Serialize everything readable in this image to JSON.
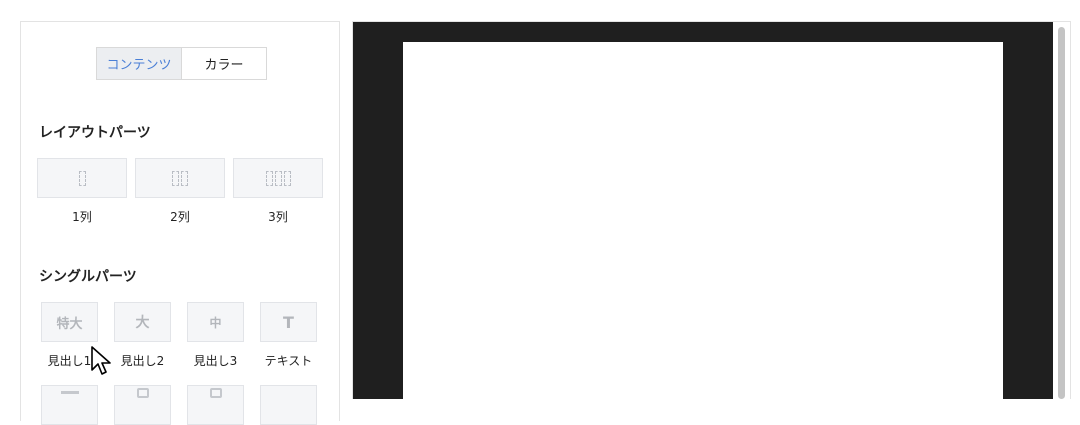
{
  "tabs": {
    "contents": "コンテンツ",
    "color": "カラー"
  },
  "layout_parts": {
    "title": "レイアウトパーツ",
    "items": [
      {
        "label": "1列"
      },
      {
        "label": "2列"
      },
      {
        "label": "3列"
      }
    ]
  },
  "single_parts": {
    "title": "シングルパーツ",
    "items": [
      {
        "icon_text": "特大",
        "label": "見出し1"
      },
      {
        "icon_text": "大",
        "label": "見出し2"
      },
      {
        "icon_text": "中",
        "label": "見出し3"
      },
      {
        "icon_text": "T",
        "label": "テキスト"
      }
    ]
  },
  "colors": {
    "accent": "#4a7fd6",
    "preview_bg": "#1f1f1f"
  }
}
